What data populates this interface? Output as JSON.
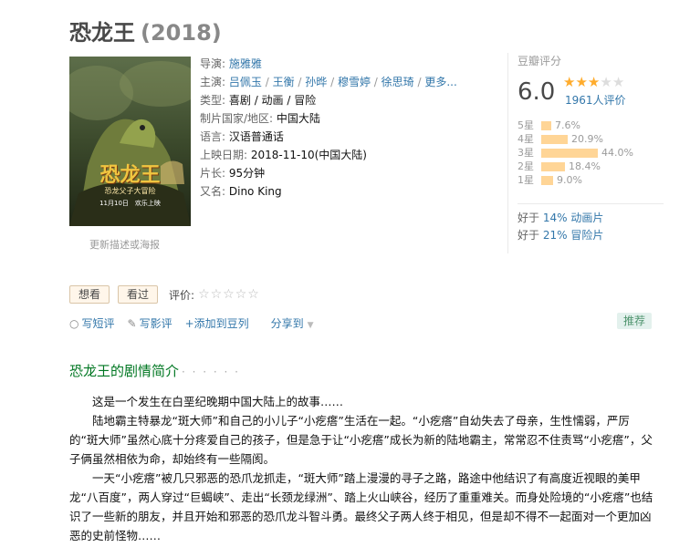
{
  "title": "恐龙王",
  "year": "(2018)",
  "poster": {
    "title_text": "恐龙王",
    "subtitle_text": "恐龙父子大冒险",
    "date_text": "11月10日　欢乐上映"
  },
  "poster_caption": "更新描述或海报",
  "info": {
    "director_label": "导演:",
    "director": "施雅雅",
    "cast_label": "主演:",
    "cast": [
      "吕佩玉",
      "王衡",
      "孙晔",
      "穆雪婷",
      "徐思琦"
    ],
    "cast_more": "更多...",
    "genre_label": "类型:",
    "genres": "喜剧 / 动画 / 冒险",
    "country_label": "制片国家/地区:",
    "country": "中国大陆",
    "language_label": "语言:",
    "language": "汉语普通话",
    "release_label": "上映日期:",
    "release": "2018-11-10(中国大陆)",
    "runtime_label": "片长:",
    "runtime": "95分钟",
    "aka_label": "又名:",
    "aka": "Dino King"
  },
  "rating": {
    "label": "豆瓣评分",
    "score": "6.0",
    "stars_filled": 3,
    "votes": "1961人评价",
    "distribution": [
      {
        "label": "5星",
        "percent": "7.6%",
        "value": 7.6
      },
      {
        "label": "4星",
        "percent": "20.9%",
        "value": 20.9
      },
      {
        "label": "3星",
        "percent": "44.0%",
        "value": 44.0
      },
      {
        "label": "2星",
        "percent": "18.4%",
        "value": 18.4
      },
      {
        "label": "1星",
        "percent": "9.0%",
        "value": 9.0
      }
    ],
    "better_than": [
      {
        "prefix": "好于",
        "percent": "14%",
        "category": "动画片"
      },
      {
        "prefix": "好于",
        "percent": "21%",
        "category": "冒险片"
      }
    ]
  },
  "actions": {
    "want": "想看",
    "seen": "看过",
    "rate_label": "评价:",
    "rate_stars": "☆☆☆☆☆"
  },
  "links": {
    "write_short": "写短评",
    "write_review": "写影评",
    "add_doulist": "+添加到豆列",
    "share": "分享到",
    "recommend": "推荐"
  },
  "synopsis": {
    "title": "恐龙王的剧情简介",
    "dots": "· · · · · ·",
    "paragraphs": [
      "这是一个发生在白垩纪晚期中国大陆上的故事……",
      "陆地霸主特暴龙“斑大师”和自己的小儿子“小疙瘩”生活在一起。“小疙瘩”自幼失去了母亲，生性懦弱，严厉的“斑大师”虽然心底十分疼爱自己的孩子，但是急于让“小疙瘩”成长为新的陆地霸主，常常忍不住责骂“小疙瘩”，父子俩虽然相依为命，却始终有一些隔阂。",
      "一天“小疙瘩”被几只邪恶的恐爪龙抓走，“斑大师”踏上漫漫的寻子之路，路途中他结识了有高度近视眼的美甲龙“八百度”，两人穿过“巨蝎峡”、走出“长颈龙绿洲”、踏上火山峡谷，经历了重重难关。而身处险境的“小疙瘩”也结识了一些新的朋友，并且开始和邪恶的恐爪龙斗智斗勇。最终父子两人终于相见，但是却不得不一起面对一个更加凶恶的史前怪物……"
    ]
  },
  "colors": {
    "link": "#3377aa",
    "star": "#ffac2d",
    "bar": "#ffd596",
    "section_title": "#007722"
  }
}
